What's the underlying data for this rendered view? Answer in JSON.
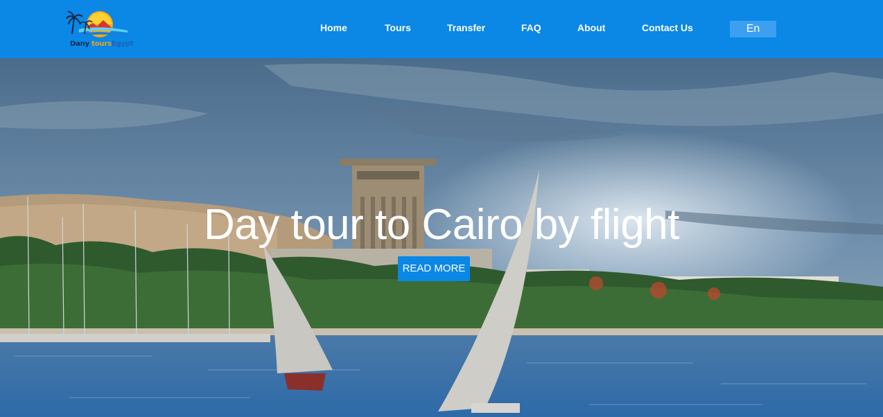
{
  "brand": {
    "logo_parts": [
      "Dany ",
      "tours",
      "Egypt"
    ],
    "colors": {
      "nav": "#0b87e5",
      "accent": "#f2a30f"
    }
  },
  "nav": {
    "items": [
      {
        "label": "Home"
      },
      {
        "label": "Tours"
      },
      {
        "label": "Transfer"
      },
      {
        "label": "FAQ"
      },
      {
        "label": "About"
      },
      {
        "label": "Contact Us"
      }
    ],
    "language": "En"
  },
  "hero": {
    "title": "Day tour to Cairo by flight",
    "button_label": "READ MORE"
  }
}
